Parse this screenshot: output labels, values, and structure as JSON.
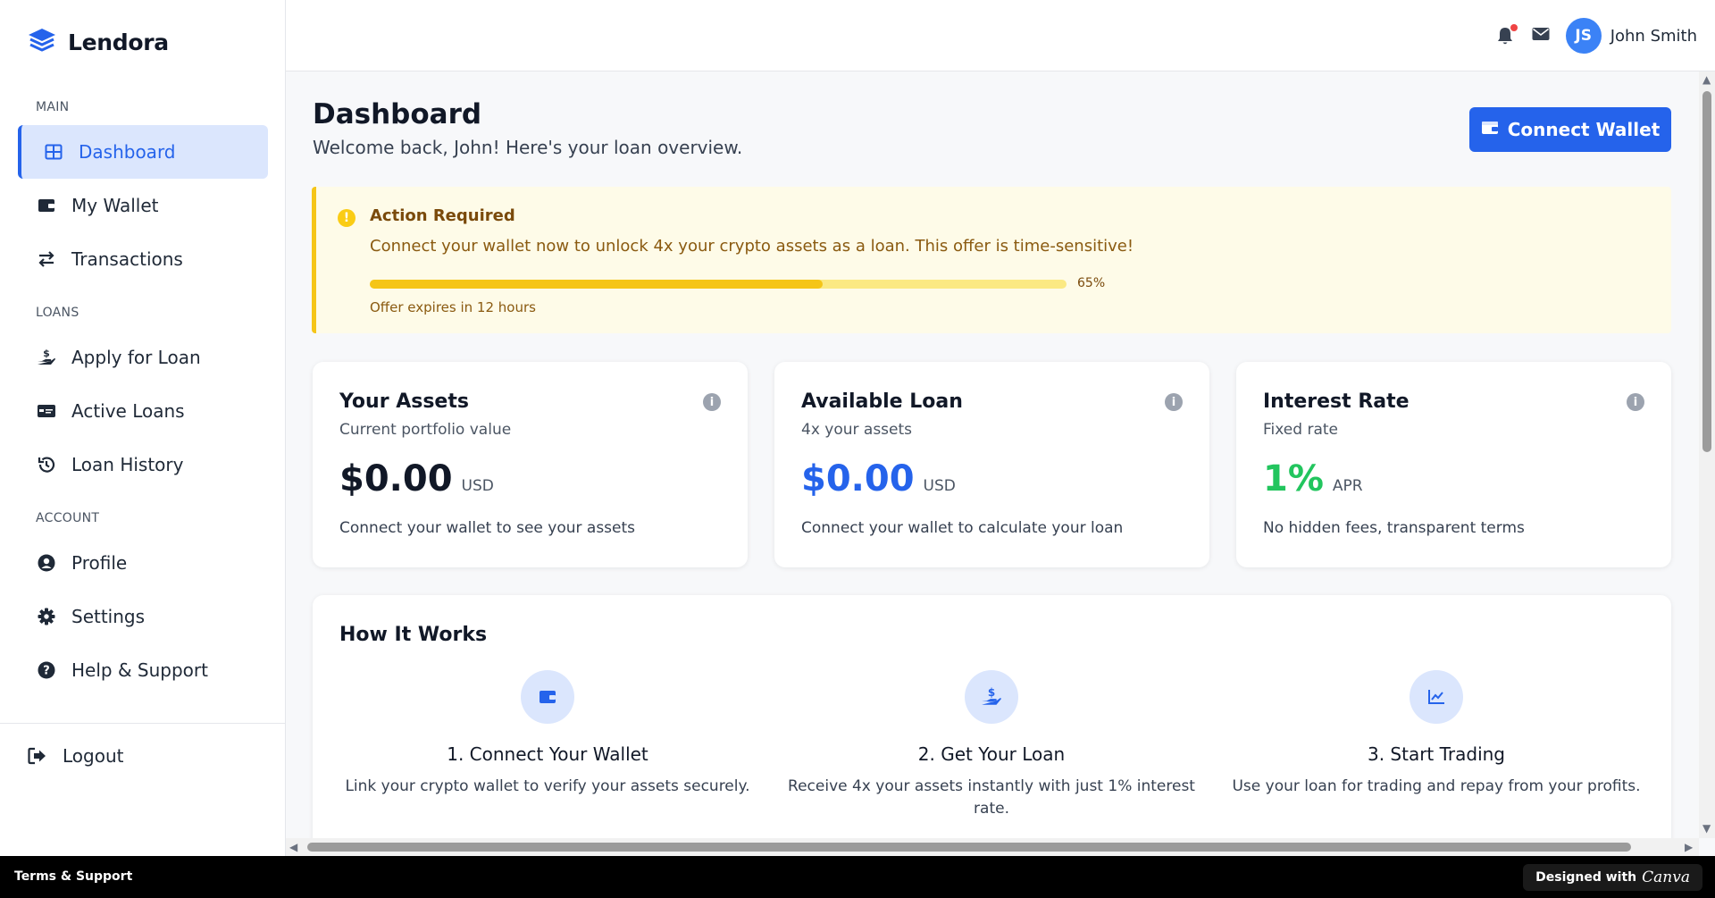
{
  "app": {
    "name": "Lendora"
  },
  "sidebar": {
    "sections": [
      {
        "label": "MAIN",
        "items": [
          {
            "label": "Dashboard",
            "icon": "grid-icon",
            "active": true
          },
          {
            "label": "My Wallet",
            "icon": "wallet-icon"
          },
          {
            "label": "Transactions",
            "icon": "exchange-icon"
          }
        ]
      },
      {
        "label": "LOANS",
        "items": [
          {
            "label": "Apply for Loan",
            "icon": "hand-dollar-icon"
          },
          {
            "label": "Active Loans",
            "icon": "credit-card-icon"
          },
          {
            "label": "Loan History",
            "icon": "history-icon"
          }
        ]
      },
      {
        "label": "ACCOUNT",
        "items": [
          {
            "label": "Profile",
            "icon": "user-circle-icon"
          },
          {
            "label": "Settings",
            "icon": "gear-icon"
          },
          {
            "label": "Help & Support",
            "icon": "question-circle-icon"
          }
        ]
      }
    ],
    "logout": "Logout"
  },
  "topbar": {
    "user_initials": "JS",
    "user_name": "John Smith",
    "has_notification": true
  },
  "header": {
    "title": "Dashboard",
    "subtitle": "Welcome back, John! Here's your loan overview.",
    "connect_button": "Connect Wallet"
  },
  "alert": {
    "title": "Action Required",
    "message": "Connect your wallet now to unlock 4x your crypto assets as a loan. This offer is time-sensitive!",
    "progress": 65,
    "progress_label": "65%",
    "footer": "Offer expires in 12 hours"
  },
  "cards": [
    {
      "title": "Your Assets",
      "subtitle": "Current portfolio value",
      "value": "$0.00",
      "unit": "USD",
      "note": "Connect your wallet to see your assets",
      "value_color": "#111827"
    },
    {
      "title": "Available Loan",
      "subtitle": "4x your assets",
      "value": "$0.00",
      "unit": "USD",
      "note": "Connect your wallet to calculate your loan",
      "value_color": "#2563eb"
    },
    {
      "title": "Interest Rate",
      "subtitle": "Fixed rate",
      "value": "1%",
      "unit": "APR",
      "note": "No hidden fees, transparent terms",
      "value_color": "#22c55e"
    }
  ],
  "how_it_works": {
    "title": "How It Works",
    "steps": [
      {
        "title": "1. Connect Your Wallet",
        "desc": "Link your crypto wallet to verify your assets securely.",
        "icon": "wallet-icon"
      },
      {
        "title": "2. Get Your Loan",
        "desc": "Receive 4x your assets instantly with just 1% interest rate.",
        "icon": "hand-dollar-icon"
      },
      {
        "title": "3. Start Trading",
        "desc": "Use your loan for trading and repay from your profits.",
        "icon": "chart-line-icon"
      }
    ]
  },
  "footer": {
    "left": "Terms & Support",
    "right_prefix": "Designed with",
    "right_brand": "Canva"
  },
  "colors": {
    "accent": "#2563eb",
    "warning": "#f5c518",
    "success": "#22c55e"
  }
}
